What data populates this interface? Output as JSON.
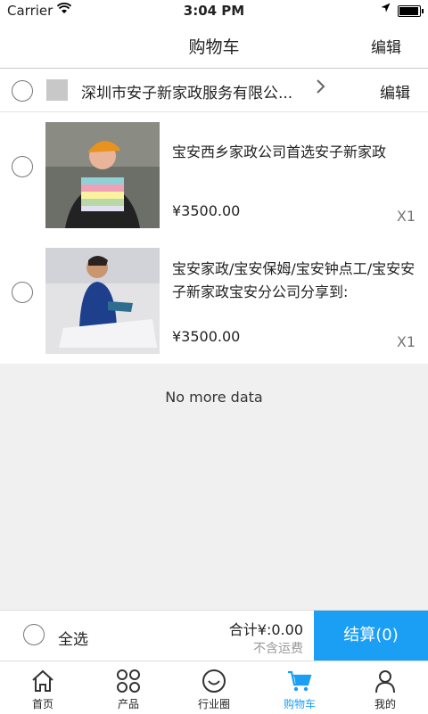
{
  "status_bar": {
    "carrier": "Carrier",
    "time": "3:04 PM"
  },
  "nav": {
    "title": "购物车",
    "edit": "编辑"
  },
  "store": {
    "name": "深圳市安子新家政服务有限公...",
    "edit": "编辑"
  },
  "items": [
    {
      "title": "宝安西乡家政公司首选安子新家政",
      "price": "¥3500.00",
      "qty": "X1"
    },
    {
      "title": "宝安家政/宝安保姆/宝安钟点工/宝安安子新家政宝安分公司分享到:",
      "price": "¥3500.00",
      "qty": "X1"
    }
  ],
  "no_more": "No more data",
  "checkout": {
    "select_all": "全选",
    "total": "合计¥:0.00",
    "shipping": "不含运费",
    "button": "结算(0)"
  },
  "tabs": [
    {
      "label": "首页",
      "icon": "home-icon"
    },
    {
      "label": "产品",
      "icon": "grid-icon"
    },
    {
      "label": "行业圈",
      "icon": "smile-icon"
    },
    {
      "label": "购物车",
      "icon": "cart-icon",
      "active": true
    },
    {
      "label": "我的",
      "icon": "user-icon"
    }
  ],
  "colors": {
    "accent": "#1a9ff5"
  }
}
